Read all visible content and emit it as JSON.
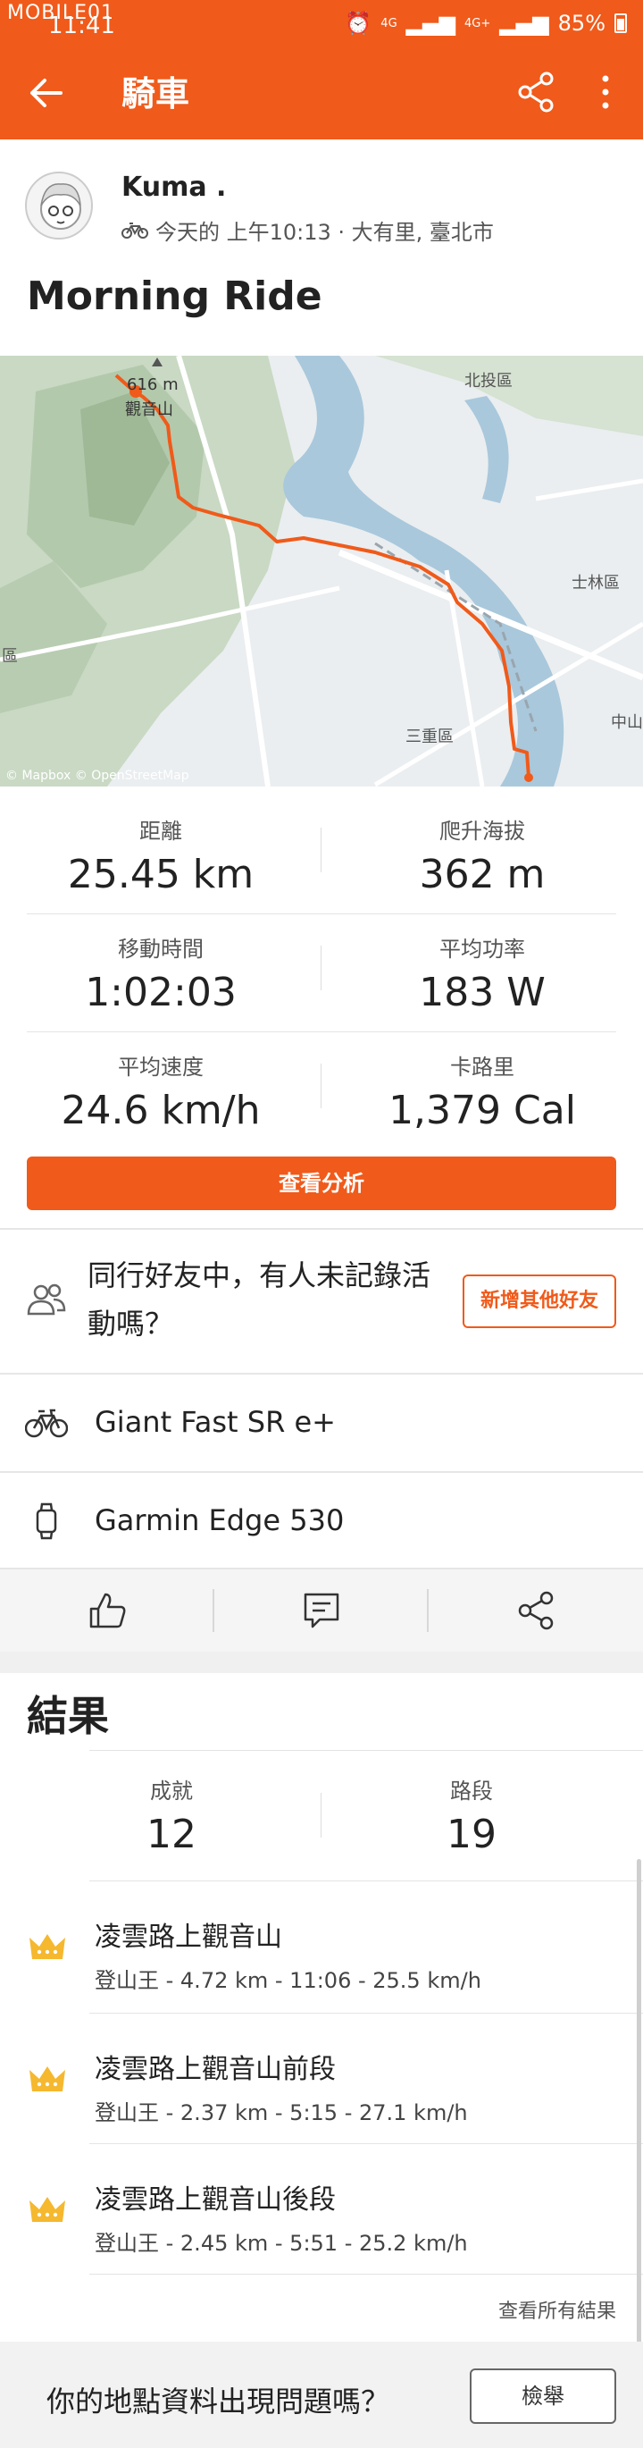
{
  "status_bar": {
    "watermark": "MOBILE01",
    "time": "11:41",
    "network_1": "4G",
    "network_2": "4G+",
    "battery": "85%"
  },
  "app_bar": {
    "title": "騎車"
  },
  "athlete": {
    "name": "Kuma .",
    "meta": "今天的 上午10:13 · 大有里, 臺北市"
  },
  "activity": {
    "title": "Morning Ride"
  },
  "map": {
    "peak_label": "616 m",
    "place_labels": [
      "觀音山",
      "北投區",
      "士林區",
      "三重區",
      "中山",
      "區"
    ],
    "attribution": "© Mapbox © OpenStreetMap",
    "route_color": "#f05a1a"
  },
  "stats": [
    {
      "label": "距離",
      "value": "25.45 km"
    },
    {
      "label": "爬升海拔",
      "value": "362 m"
    },
    {
      "label": "移動時間",
      "value": "1:02:03"
    },
    {
      "label": "平均功率",
      "value": "183 W"
    },
    {
      "label": "平均速度",
      "value": "24.6 km/h"
    },
    {
      "label": "卡路里",
      "value": "1,379 Cal"
    }
  ],
  "analysis_button": "查看分析",
  "friends": {
    "text": "同行好友中，有人未記錄活動嗎？",
    "button": "新增其他好友"
  },
  "gear": {
    "bike": "Giant Fast SR e+",
    "device": "Garmin Edge 530"
  },
  "results": {
    "title": "結果",
    "achievements_label": "成就",
    "achievements_value": "12",
    "segments_label": "路段",
    "segments_value": "19",
    "segments": [
      {
        "name": "凌雲路上觀音山",
        "info": "登山王 - 4.72 km - 11:06 - 25.5 km/h"
      },
      {
        "name": "凌雲路上觀音山前段",
        "info": "登山王 - 2.37 km - 5:15 - 27.1 km/h"
      },
      {
        "name": "凌雲路上觀音山後段",
        "info": "登山王 - 2.45 km - 5:51 - 25.2 km/h"
      }
    ],
    "view_all": "查看所有結果"
  },
  "report": {
    "question": "你的地點資料出現問題嗎？",
    "button": "檢舉"
  },
  "colors": {
    "brand": "#f05a1a",
    "crown": "#f5b82e"
  }
}
